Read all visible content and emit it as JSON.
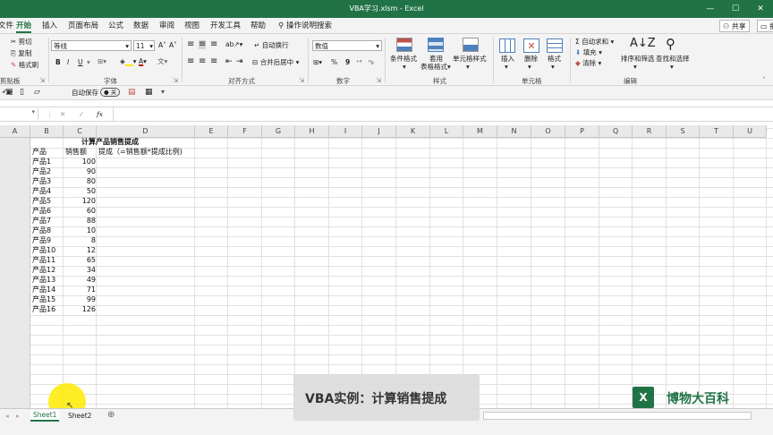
{
  "window": {
    "title": "VBA学习.xlsm  -  Excel",
    "minimize": "—",
    "maximize": "☐",
    "close": "✕"
  },
  "tabs": [
    "文件",
    "开始",
    "插入",
    "页面布局",
    "公式",
    "数据",
    "审阅",
    "视图",
    "开发工具",
    "帮助"
  ],
  "tell_me": "操作说明搜索",
  "share": "共享",
  "comment": "批",
  "clipboard": {
    "cut": "剪切",
    "copy": "复制",
    "painter": "格式刷",
    "label": "剪贴板"
  },
  "font": {
    "name": "等线",
    "size": "11",
    "bold": "B",
    "italic": "I",
    "underline": "U",
    "grow": "A˄",
    "shrink": "A˅",
    "font_color": "A",
    "label": "字体"
  },
  "alignment": {
    "wrap": "自动换行",
    "merge": "合并后居中",
    "label": "对齐方式"
  },
  "number": {
    "format": "数值",
    "percent": "%",
    "comma": "9",
    "label": "数字"
  },
  "styles": {
    "conditional": "条件格式",
    "table1": "套用",
    "table2": "表格格式",
    "cell_styles": "单元格样式",
    "label": "样式"
  },
  "cells": {
    "insert": "插入",
    "delete": "删除",
    "format": "格式",
    "label": "单元格"
  },
  "editing": {
    "autosum": "自动求和",
    "fill": "填充",
    "clear": "清除",
    "sort": "排序和筛选",
    "find": "查找和选择",
    "label": "编辑"
  },
  "qat": {
    "autosave": "自动保存",
    "autosave_state": "关"
  },
  "formula_bar": {
    "fx": "fx",
    "cancel": "✕",
    "enter": "✓"
  },
  "columns": [
    "A",
    "B",
    "C",
    "D",
    "E",
    "F",
    "G",
    "H",
    "I",
    "J",
    "K",
    "L",
    "M",
    "N",
    "O",
    "P",
    "Q",
    "R",
    "S",
    "T",
    "U"
  ],
  "sheet": {
    "title": "计算产品销售提成",
    "header_product": "产品",
    "header_sales": "销售额",
    "header_commission": "提成（=销售额*提成比例)",
    "products": [
      "产品1",
      "产品2",
      "产品3",
      "产品4",
      "产品5",
      "产品6",
      "产品7",
      "产品8",
      "产品9",
      "产品10",
      "产品11",
      "产品12",
      "产品13",
      "产品14",
      "产品15",
      "产品16"
    ],
    "sales": [
      "100",
      "90",
      "80",
      "50",
      "120",
      "60",
      "88",
      "10",
      "8",
      "12",
      "65",
      "34",
      "49",
      "71",
      "99",
      "126"
    ]
  },
  "sheet_tabs": [
    "Sheet1",
    "Sheet2"
  ],
  "add_sheet": "⊕",
  "caption": "VBA实例：计算销售提成",
  "brand": "博物大百科",
  "brand_icon": "X",
  "colors": {
    "excel_green": "#217346",
    "highlight": "#ffeb00"
  }
}
